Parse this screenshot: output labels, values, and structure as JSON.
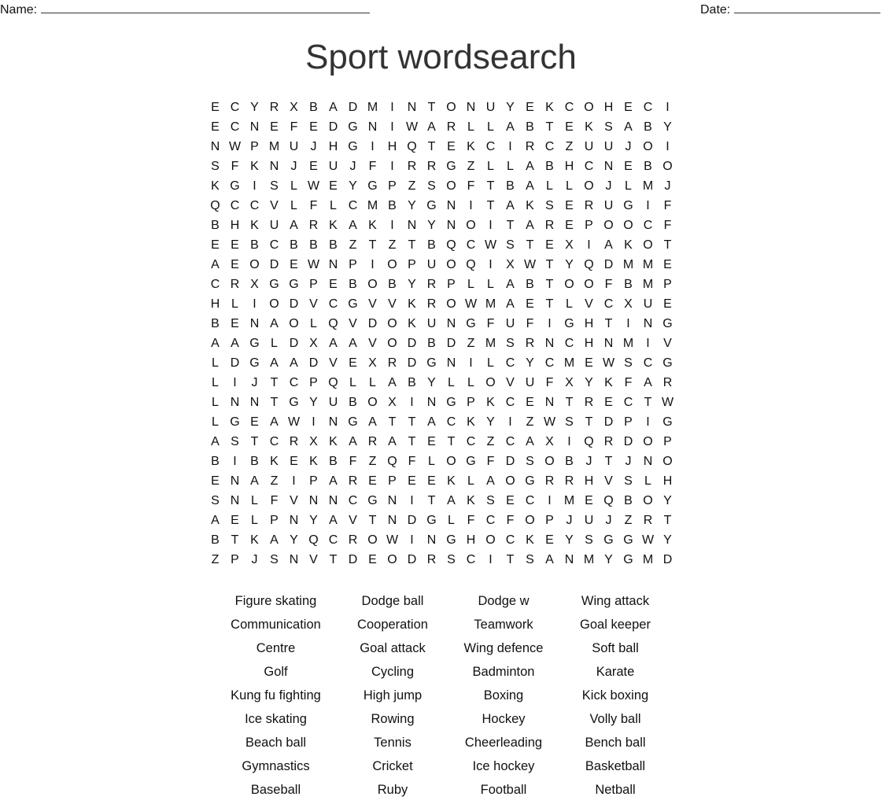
{
  "header": {
    "name_label": "Name:",
    "date_label": "Date:"
  },
  "title": "Sport wordsearch",
  "grid": [
    "ECYRXBADMINTONUYEKCOHECI",
    "ECNEFEDGNIWARLLABTEKSABY",
    "NWPMUJHGIHQTEKCIRCZUUJOI",
    "SFKNJEUJFIRRGZLLABHCNEBO",
    "KGISLWEYGPZSOFTBALLOJLMJ",
    "QCCVLFLCMBYGNITAKSERUGIF",
    "BHKUARKAKINYNOITAREPOOCF",
    "EEBCBBBZTZTBQCWSTEXIAKOT",
    "AEODEWNPIOPUOQIXWTYQDMME",
    "CRXGGPEBOBYRPLLABTOOFBMP",
    "HLIODVCGVVKROWMAETLVCXUE",
    "BENAOLQVDOKUNGFUFIGHTING",
    "AAGLDXAAVODBDZMSRNCHNMIV",
    "LDGAADVEXRDGNILCYCMEWSCG",
    "LIJTCPQLLABYLLOVUFXYKFAR",
    "LNNTGYUBOXINGPKCENTRECTW",
    "LGEAWINGATTACKYIZWSTDPIG",
    "ASTCRXKARATETCZCAXIQRDOP",
    "BIBKEKBFZQFLOGFDSOBJTJNO",
    "ENAZIPAREPEEKLAOGRRHVSLH",
    "SNLFVNNCGNITAKSECIMEQBOY",
    "AELPNYAVTNDGLFCFOPJUJZRT",
    "BTKAYQCROWINGHOCKEYSGGWY",
    "ZPJSNVTDEODRSCITSANMYGMD"
  ],
  "words": [
    "Figure skating",
    "Dodge ball",
    "Dodge w",
    "Wing attack",
    "Communication",
    "Cooperation",
    "Teamwork",
    "Goal keeper",
    "Centre",
    "Goal attack",
    "Wing defence",
    "Soft ball",
    "Golf",
    "Cycling",
    "Badminton",
    "Karate",
    "Kung fu fighting",
    "High jump",
    "Boxing",
    "Kick boxing",
    "Ice skating",
    "Rowing",
    "Hockey",
    "Volly ball",
    "Beach ball",
    "Tennis",
    "Cheerleading",
    "Bench ball",
    "Gymnastics",
    "Cricket",
    "Ice hockey",
    "Basketball",
    "Baseball",
    "Ruby",
    "Football",
    "Netball"
  ]
}
